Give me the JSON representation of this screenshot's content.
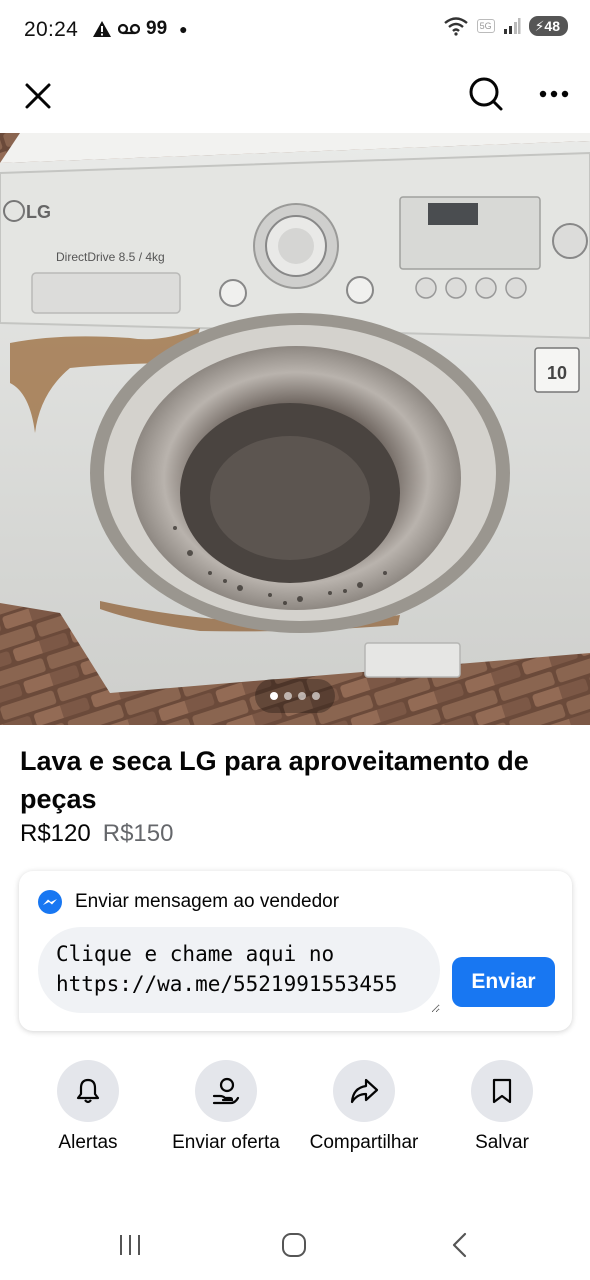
{
  "status_bar": {
    "time": "20:24",
    "left_icons": [
      "warning-icon",
      "voicemail-icon"
    ],
    "left_number": "99",
    "network": "5G",
    "battery": "48"
  },
  "top_bar": {
    "icons": [
      "close-icon",
      "search-icon",
      "more-icon"
    ]
  },
  "photo": {
    "description_alt": "",
    "brand_text": "LG",
    "model_text": "DirectDrive 8.5 / 4kg",
    "pager_count": 4,
    "pager_active": 1
  },
  "listing": {
    "title": "Lava e seca LG para aproveitamento de peças",
    "price": "R$120",
    "original_price": "R$150"
  },
  "message": {
    "header": "Enviar mensagem ao vendedor",
    "input_value": "Clique e chame aqui no https://wa.me/5521991553455",
    "send_label": "Enviar"
  },
  "actions": [
    {
      "label": "Alertas",
      "icon": "bell-icon"
    },
    {
      "label": "Enviar oferta",
      "icon": "offer-icon"
    },
    {
      "label": "Compartilhar",
      "icon": "share-icon"
    },
    {
      "label": "Salvar",
      "icon": "bookmark-icon"
    }
  ],
  "colors": {
    "accent": "#1877f2",
    "secondary_text": "#65676b",
    "chip_bg": "#e4e6eb"
  }
}
